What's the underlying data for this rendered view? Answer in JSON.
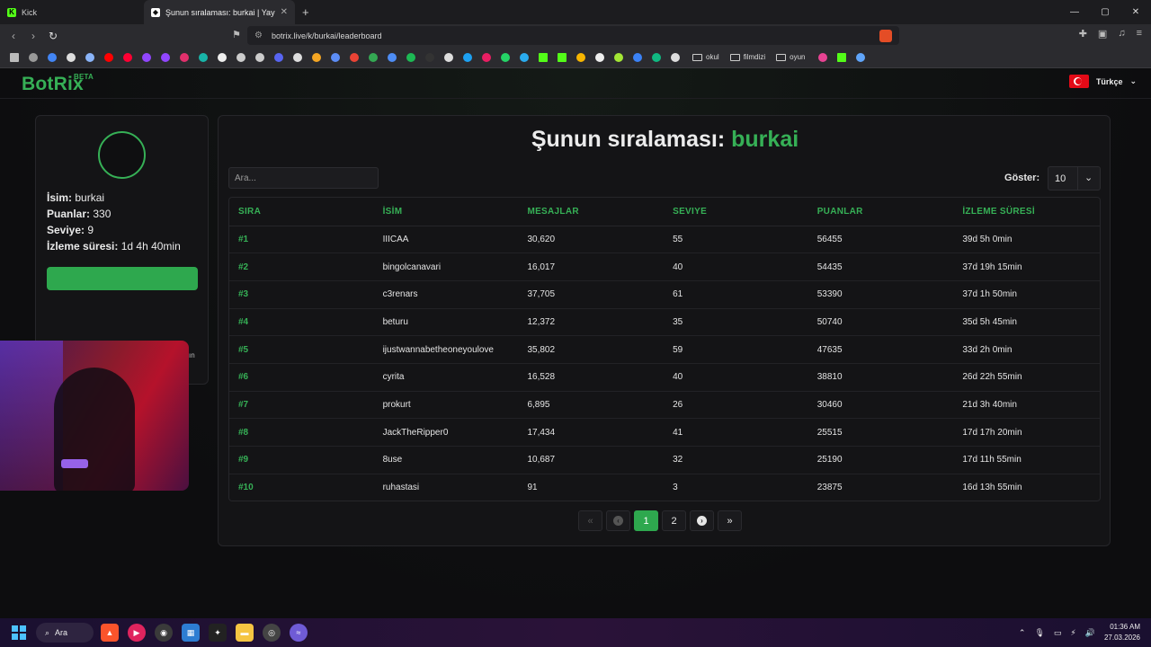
{
  "browser": {
    "tabs": [
      {
        "label": "Kick",
        "active": false,
        "favicon": "kick-icon"
      },
      {
        "label": "Şunun sıralaması: burkai | Yayınc",
        "active": true,
        "favicon": "botrix-icon"
      }
    ],
    "url": "botrix.live/k/burkai/leaderboard",
    "bookmarks_folders": [
      "okul",
      "filmdizi",
      "oyun"
    ]
  },
  "site": {
    "logo": "BotRix",
    "logo_badge": "BETA",
    "language": "Türkçe"
  },
  "profile": {
    "name_label": "İsim:",
    "name_value": "burkai",
    "points_label": "Puanlar:",
    "points_value": "330",
    "level_label": "Seviye:",
    "level_value": "9",
    "watch_label": "İzleme süresi:",
    "watch_value": "1d 4h 40min",
    "hint_fragment": "sın"
  },
  "leaderboard": {
    "title_prefix": "Şunun sıralaması:",
    "title_name": "burkai",
    "search_placeholder": "Ara...",
    "show_label": "Göster:",
    "show_value": "10",
    "columns": [
      "SIRA",
      "İSİM",
      "MESAJLAR",
      "SEVIYE",
      "PUANLAR",
      "İZLEME SÜRESİ"
    ],
    "rows": [
      {
        "rank": "#1",
        "name": "IIICAA",
        "messages": "30,620",
        "level": "55",
        "points": "56455",
        "watch": "39d 5h 0min"
      },
      {
        "rank": "#2",
        "name": "bingolcanavari",
        "messages": "16,017",
        "level": "40",
        "points": "54435",
        "watch": "37d 19h 15min"
      },
      {
        "rank": "#3",
        "name": "c3renars",
        "messages": "37,705",
        "level": "61",
        "points": "53390",
        "watch": "37d 1h 50min"
      },
      {
        "rank": "#4",
        "name": "beturu",
        "messages": "12,372",
        "level": "35",
        "points": "50740",
        "watch": "35d 5h 45min"
      },
      {
        "rank": "#5",
        "name": "ijustwannabetheoneyoulove",
        "messages": "35,802",
        "level": "59",
        "points": "47635",
        "watch": "33d 2h 0min"
      },
      {
        "rank": "#6",
        "name": "cyrita",
        "messages": "16,528",
        "level": "40",
        "points": "38810",
        "watch": "26d 22h 55min"
      },
      {
        "rank": "#7",
        "name": "prokurt",
        "messages": "6,895",
        "level": "26",
        "points": "30460",
        "watch": "21d 3h 40min"
      },
      {
        "rank": "#8",
        "name": "JackTheRipper0",
        "messages": "17,434",
        "level": "41",
        "points": "25515",
        "watch": "17d 17h 20min"
      },
      {
        "rank": "#9",
        "name": "8use",
        "messages": "10,687",
        "level": "32",
        "points": "25190",
        "watch": "17d 11h 55min"
      },
      {
        "rank": "#10",
        "name": "ruhastasi",
        "messages": "91",
        "level": "3",
        "points": "23875",
        "watch": "16d 13h 55min"
      }
    ],
    "pagination": {
      "pages": [
        "1",
        "2"
      ],
      "current": "1"
    }
  },
  "taskbar": {
    "search_label": "Ara",
    "time": "01:36 AM",
    "date": "27.03.2026"
  },
  "colors": {
    "accent": "#36b056",
    "background": "#0e0e10",
    "card": "#141416"
  }
}
